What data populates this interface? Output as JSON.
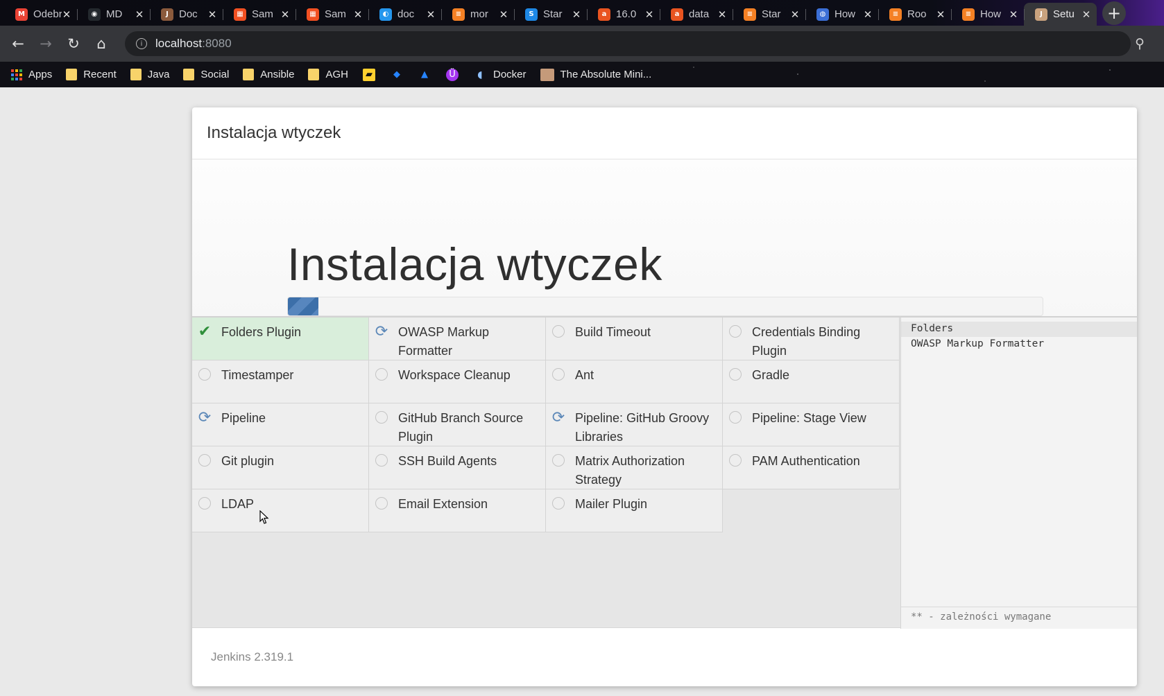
{
  "browser": {
    "tabs": [
      {
        "title": "Odebrane",
        "favicon": "gmail-icon",
        "color": "#ea4335",
        "glyph": "M"
      },
      {
        "title": "MD",
        "favicon": "github-icon",
        "color": "#24292e",
        "glyph": "◉"
      },
      {
        "title": "Doc",
        "favicon": "jenkins-icon",
        "color": "#8b5a3c",
        "glyph": "J"
      },
      {
        "title": "Sam",
        "favicon": "microsoft-icon",
        "color": "#f25022",
        "glyph": "▦"
      },
      {
        "title": "Sam",
        "favicon": "microsoft-icon",
        "color": "#f25022",
        "glyph": "▦"
      },
      {
        "title": "doc",
        "favicon": "docker-icon",
        "color": "#2496ed",
        "glyph": "◐"
      },
      {
        "title": "mor",
        "favicon": "stackoverflow-icon",
        "color": "#f48024",
        "glyph": "≡"
      },
      {
        "title": "Star",
        "favicon": "stackexchange-icon",
        "color": "#1e88e5",
        "glyph": "S"
      },
      {
        "title": "16.0",
        "favicon": "askubuntu-icon",
        "color": "#e95420",
        "glyph": "a"
      },
      {
        "title": "data",
        "favicon": "askubuntu-icon",
        "color": "#e95420",
        "glyph": "a"
      },
      {
        "title": "Star",
        "favicon": "stackoverflow-icon",
        "color": "#f48024",
        "glyph": "≡"
      },
      {
        "title": "How",
        "favicon": "globe-icon",
        "color": "#3b6fd6",
        "glyph": "◍"
      },
      {
        "title": "Roo",
        "favicon": "stackoverflow-icon",
        "color": "#f48024",
        "glyph": "≡"
      },
      {
        "title": "How",
        "favicon": "stackoverflow-icon",
        "color": "#f48024",
        "glyph": "≡"
      },
      {
        "title": "Setu",
        "favicon": "jenkins-icon",
        "color": "#c9a27e",
        "glyph": "J",
        "active": true
      }
    ],
    "tab_close": "✕",
    "new_tab": "+",
    "url_host": "localhost",
    "url_port": ":8080",
    "bookmarks": [
      {
        "label": "Apps",
        "type": "apps"
      },
      {
        "label": "Recent",
        "type": "folder"
      },
      {
        "label": "Java",
        "type": "folder"
      },
      {
        "label": "Social",
        "type": "folder"
      },
      {
        "label": "Ansible",
        "type": "folder"
      },
      {
        "label": "AGH",
        "type": "folder"
      }
    ],
    "bookmarks_tail": [
      {
        "label": "Docker",
        "icon": "docker-whale-icon"
      },
      {
        "label": "The Absolute Mini...",
        "icon": "portrait-icon"
      }
    ]
  },
  "dialog": {
    "header_title": "Instalacja wtyczek",
    "hero_title": "Instalacja wtyczek",
    "progress": 0.04,
    "plugins": [
      {
        "name": "Folders Plugin",
        "status": "done"
      },
      {
        "name": "OWASP Markup Formatter",
        "status": "installing"
      },
      {
        "name": "Build Timeout",
        "status": "pending"
      },
      {
        "name": "Credentials Binding Plugin",
        "status": "pending"
      },
      {
        "name": "Timestamper",
        "status": "pending"
      },
      {
        "name": "Workspace Cleanup",
        "status": "pending"
      },
      {
        "name": "Ant",
        "status": "pending"
      },
      {
        "name": "Gradle",
        "status": "pending"
      },
      {
        "name": "Pipeline",
        "status": "installing"
      },
      {
        "name": "GitHub Branch Source Plugin",
        "status": "pending"
      },
      {
        "name": "Pipeline: GitHub Groovy Libraries",
        "status": "installing"
      },
      {
        "name": "Pipeline: Stage View",
        "status": "pending"
      },
      {
        "name": "Git plugin",
        "status": "pending"
      },
      {
        "name": "SSH Build Agents",
        "status": "pending"
      },
      {
        "name": "Matrix Authorization Strategy",
        "status": "pending"
      },
      {
        "name": "PAM Authentication",
        "status": "pending"
      },
      {
        "name": "LDAP",
        "status": "pending"
      },
      {
        "name": "Email Extension",
        "status": "pending"
      },
      {
        "name": "Mailer Plugin",
        "status": "pending"
      }
    ],
    "log_lines": [
      "Folders",
      "OWASP Markup Formatter"
    ],
    "deps_note": "** - zależności wymagane",
    "footer_version": "Jenkins 2.319.1"
  }
}
